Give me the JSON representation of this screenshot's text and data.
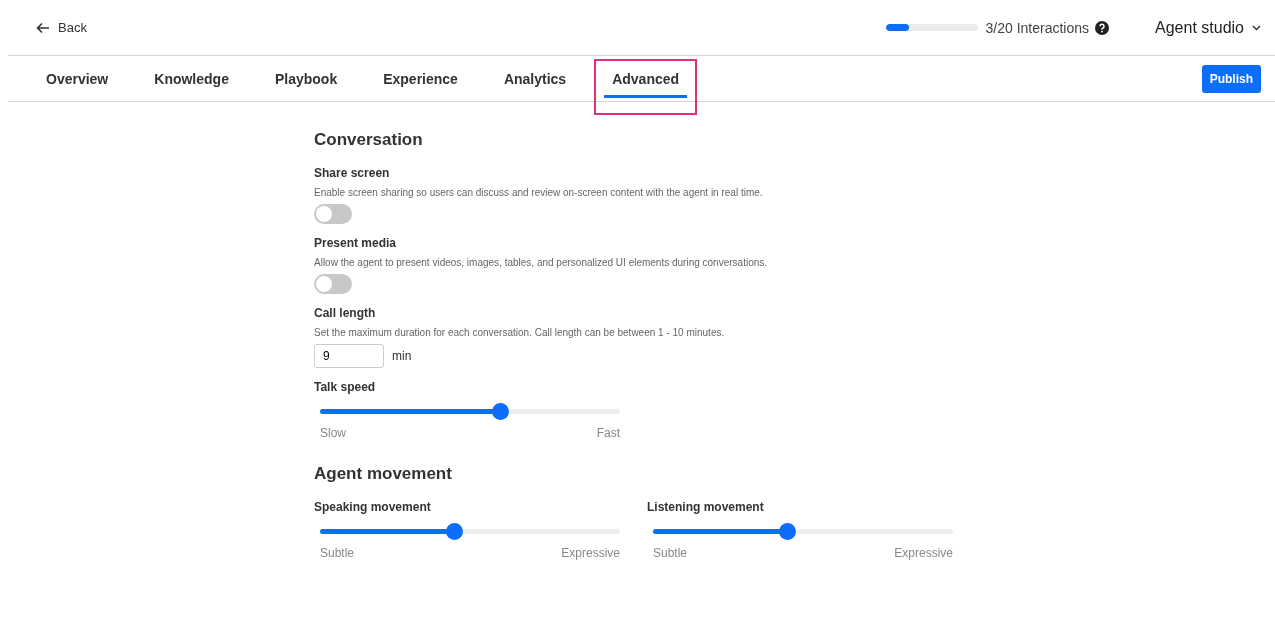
{
  "header": {
    "back": "Back",
    "usage": {
      "level": 0.25,
      "label": "3/20 Interactions"
    },
    "workspace": "Agent studio"
  },
  "tabs": [
    {
      "label": "Overview",
      "selected": false,
      "highlighted": false
    },
    {
      "label": "Knowledge",
      "selected": false,
      "highlighted": false
    },
    {
      "label": "Playbook",
      "selected": false,
      "highlighted": false
    },
    {
      "label": "Experience",
      "selected": false,
      "highlighted": false
    },
    {
      "label": "Analytics",
      "selected": false,
      "highlighted": false
    },
    {
      "label": "Advanced",
      "selected": true,
      "highlighted": true
    }
  ],
  "publish": "Publish",
  "sections": [
    {
      "title": "Conversation",
      "settings": [
        {
          "kind": "toggle",
          "label": "Share screen",
          "description": "Enable screen sharing so users can discuss and review on-screen content with the agent in real time.",
          "on": false
        },
        {
          "kind": "toggle",
          "label": "Present media",
          "description": "Allow the agent to present videos, images, tables, and personalized UI elements during conversations.",
          "on": false
        },
        {
          "kind": "number",
          "label": "Call length",
          "description": "Set the maximum duration for each conversation. Call length can be between 1 - 10 minutes.",
          "value": "9",
          "unit": "min"
        },
        {
          "kind": "slider",
          "label": "Talk speed",
          "level": 0.6,
          "min_label": "Slow",
          "max_label": "Fast"
        }
      ]
    },
    {
      "title": "Agent movement",
      "columns": true,
      "settings": [
        {
          "kind": "slider",
          "label": "Speaking movement",
          "level": 0.445,
          "min_label": "Subtle",
          "max_label": "Expressive"
        },
        {
          "kind": "slider",
          "label": "Listening movement",
          "level": 0.445,
          "min_label": "Subtle",
          "max_label": "Expressive"
        }
      ]
    }
  ]
}
